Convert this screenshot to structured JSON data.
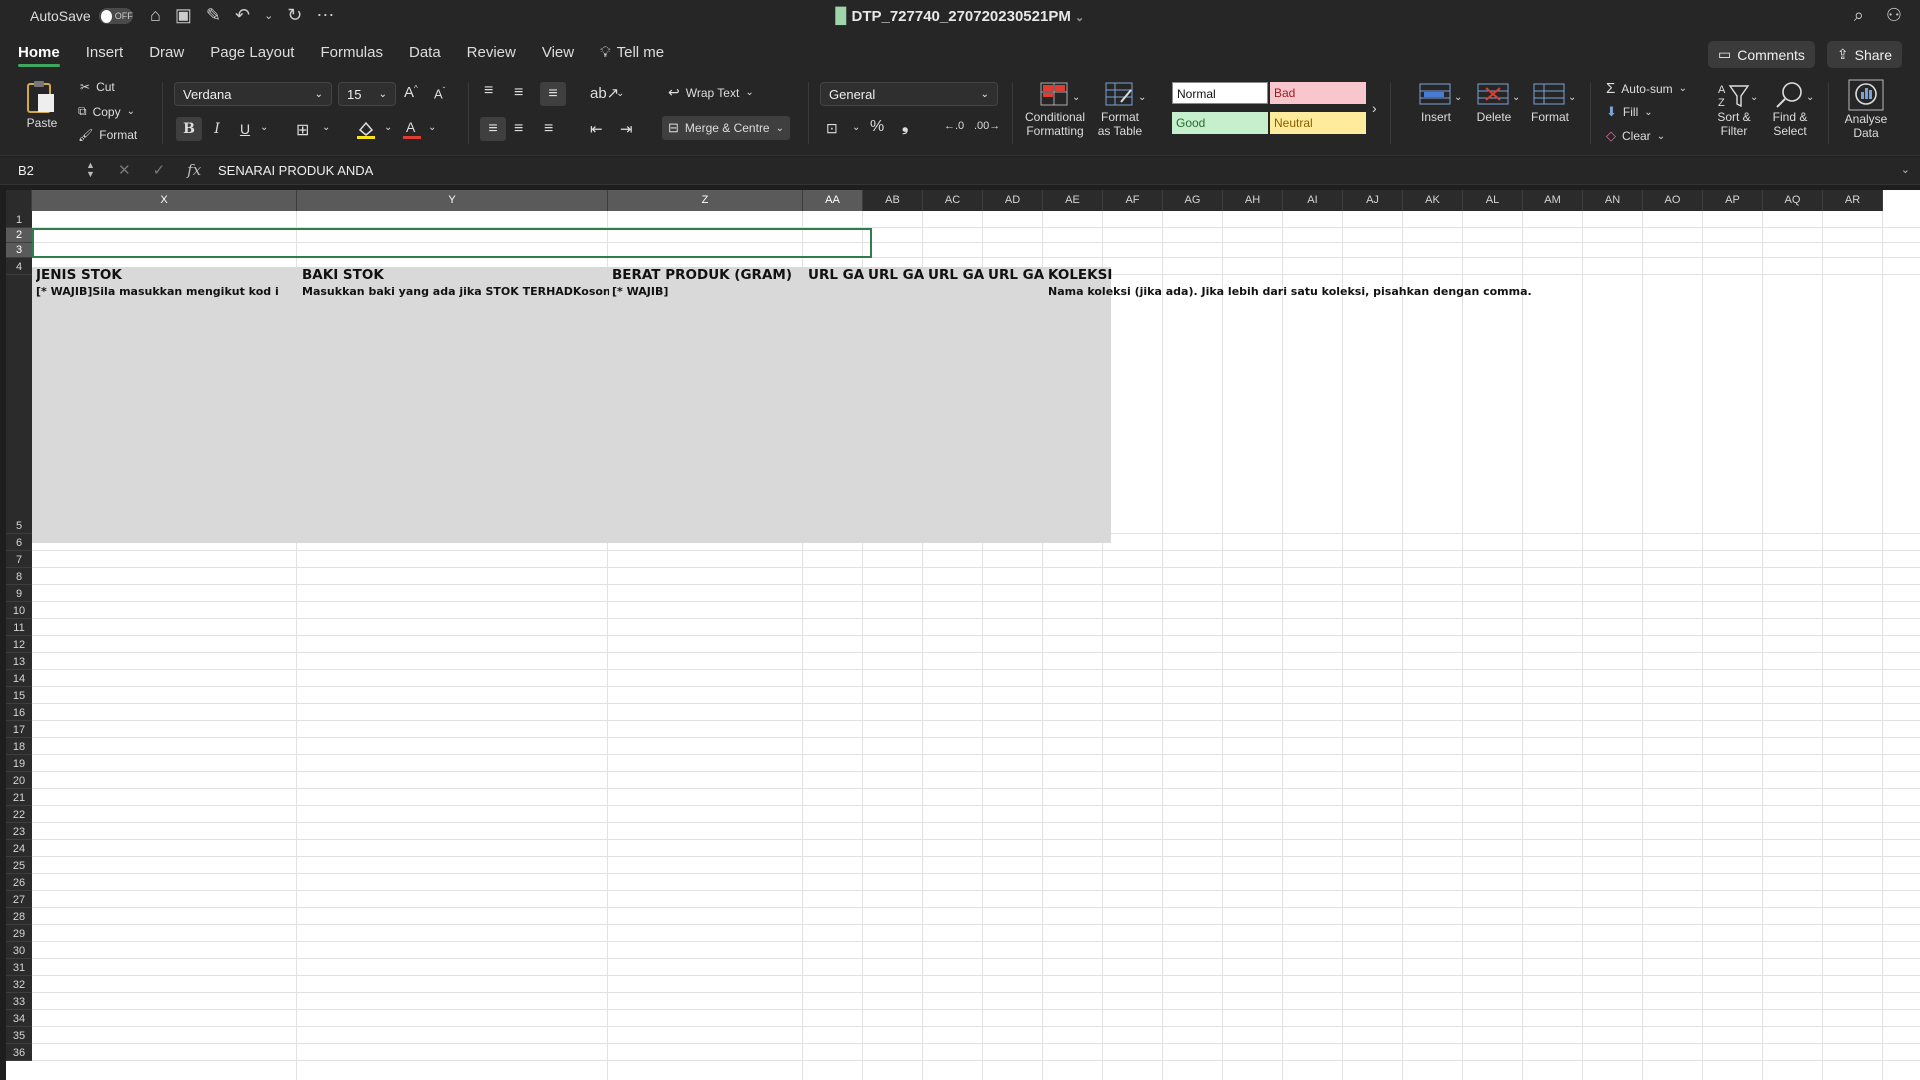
{
  "titlebar": {
    "autosave_label": "AutoSave",
    "autosave_state": "OFF",
    "doc_title": "DTP_727740_270720230521PM"
  },
  "menu": {
    "tabs": [
      "Home",
      "Insert",
      "Draw",
      "Page Layout",
      "Formulas",
      "Data",
      "Review",
      "View"
    ],
    "tell_me": "Tell me",
    "comments": "Comments",
    "share": "Share"
  },
  "ribbon": {
    "paste": "Paste",
    "cut": "Cut",
    "copy": "Copy",
    "format_painter": "Format",
    "font_name": "Verdana",
    "font_size": "15",
    "bold": "B",
    "italic": "I",
    "underline": "U",
    "wrap_text": "Wrap Text",
    "merge_centre": "Merge & Centre",
    "number_format": "General",
    "conditional_formatting": [
      "Conditional",
      "Formatting"
    ],
    "format_as_table": [
      "Format",
      "as Table"
    ],
    "styles": {
      "normal": "Normal",
      "bad": "Bad",
      "good": "Good",
      "neutral": "Neutral"
    },
    "insert": "Insert",
    "delete": "Delete",
    "format": "Format",
    "autosum": "Auto-sum",
    "fill": "Fill",
    "clear": "Clear",
    "sort_filter": [
      "Sort &",
      "Filter"
    ],
    "find_select": [
      "Find &",
      "Select"
    ],
    "analyse_data": [
      "Analyse",
      "Data"
    ]
  },
  "formula_bar": {
    "name_box": "B2",
    "formula": "SENARAI PRODUK ANDA"
  },
  "sheet": {
    "columns": [
      "X",
      "Y",
      "Z",
      "AA",
      "AB",
      "AC",
      "AD",
      "AE",
      "AF",
      "AG",
      "AH",
      "AI",
      "AJ",
      "AK",
      "AL",
      "AM",
      "AN",
      "AO",
      "AP",
      "AQ",
      "AR"
    ],
    "rows": [
      "1",
      "2",
      "3",
      "4",
      "5",
      "6",
      "7",
      "8",
      "9",
      "10",
      "11",
      "12",
      "13",
      "14",
      "15",
      "16",
      "17",
      "18",
      "19",
      "20",
      "21",
      "22",
      "23",
      "24",
      "25",
      "26",
      "27",
      "28",
      "29",
      "30",
      "31",
      "32",
      "33",
      "34",
      "35",
      "36"
    ],
    "row4_headers": {
      "x": "JENIS STOK",
      "y": "BAKI STOK",
      "z": "BERAT PRODUK (GRAM)",
      "aa": "URL GA",
      "ab": "URL GA",
      "ac": "URL GA",
      "ad": "URL GA",
      "ae": "KOLEKSI"
    },
    "row4_sub": {
      "x": "[* WAJIB]Sila masukkan mengikut kod i",
      "y": "Masukkan baki yang ada jika STOK TERHADKosongkan",
      "z": "[* WAJIB]",
      "ae": "Nama koleksi (jika ada). Jika lebih dari satu koleksi, pisahkan dengan comma."
    }
  }
}
